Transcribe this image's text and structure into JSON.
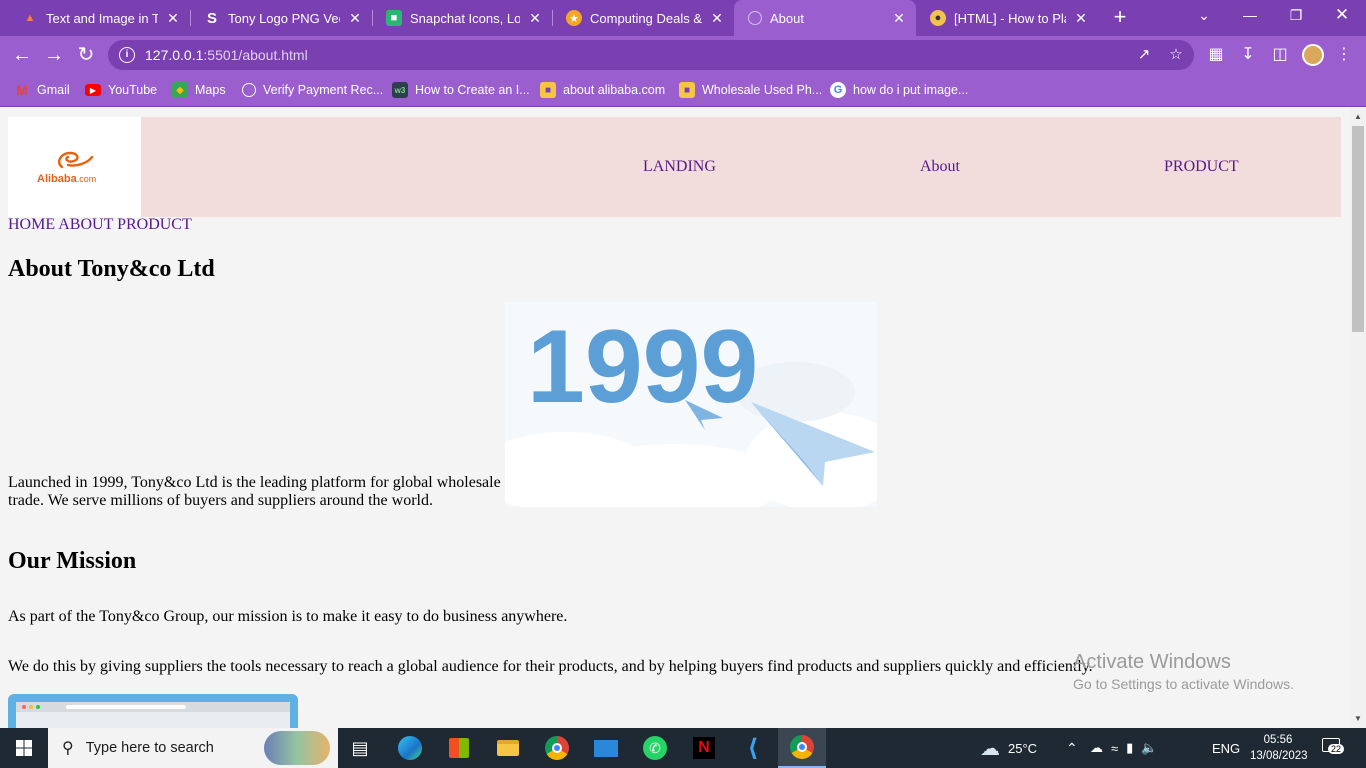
{
  "browser": {
    "tabs": [
      {
        "title": "Text and Image in Tabl",
        "favicon": "html-icon",
        "active": false
      },
      {
        "title": "Tony Logo PNG Vector",
        "favicon": "s-logo-icon",
        "active": false
      },
      {
        "title": "Snapchat Icons, Logos",
        "favicon": "iconscout-icon",
        "active": false
      },
      {
        "title": "Computing Deals & Offers",
        "favicon": "star-badge-icon",
        "active": false
      },
      {
        "title": "About",
        "favicon": "globe-icon",
        "active": true
      },
      {
        "title": "[HTML] - How to Place",
        "favicon": "robot-icon",
        "active": false
      }
    ],
    "address": {
      "host": "127.0.0.1",
      "path": ":5501/about.html"
    },
    "bookmarks": [
      {
        "label": "Gmail",
        "icon": "gmail-icon"
      },
      {
        "label": "YouTube",
        "icon": "youtube-icon"
      },
      {
        "label": "Maps",
        "icon": "maps-icon"
      },
      {
        "label": "Verify Payment Rec...",
        "icon": "globe-icon"
      },
      {
        "label": "How to Create an I...",
        "icon": "w3-icon"
      },
      {
        "label": "about alibaba.com",
        "icon": "folder-icon"
      },
      {
        "label": "Wholesale Used Ph...",
        "icon": "folder-icon"
      },
      {
        "label": "how do i put image...",
        "icon": "google-icon"
      }
    ],
    "accent": "#9a5ecf",
    "frame_color": "#7a3fb0"
  },
  "page": {
    "logo": {
      "brand": "Alibaba",
      "suffix": ".com",
      "color": "#e8610f"
    },
    "nav": {
      "landing": "LANDING",
      "about": "About",
      "product": "PRODUCT"
    },
    "subnav": {
      "home": "HOME",
      "about": "ABOUT",
      "product": "PRODUCT"
    },
    "about_heading": "About Tony&co Ltd",
    "about_text": "Launched in 1999, Tony&co Ltd is the leading platform for global wholesale trade. We serve millions of buyers and suppliers around the world.",
    "about_image_text": "1999",
    "mission_heading": "Our Mission",
    "mission_p1": "As part of the Tony&co Group, our mission is to make it easy to do business anywhere.",
    "mission_p2": "We do this by giving suppliers the tools necessary to reach a global audience for their products, and by helping buyers find products and suppliers quickly and efficiently.",
    "header_bg": "#f3dcdc",
    "link_color": "#551a8b"
  },
  "watermark": {
    "title": "Activate Windows",
    "subtitle": "Go to Settings to activate Windows."
  },
  "taskbar": {
    "search_placeholder": "Type here to search",
    "weather": "25°C",
    "language": "ENG",
    "time": "05:56",
    "date": "13/08/2023",
    "notifications": "22"
  }
}
